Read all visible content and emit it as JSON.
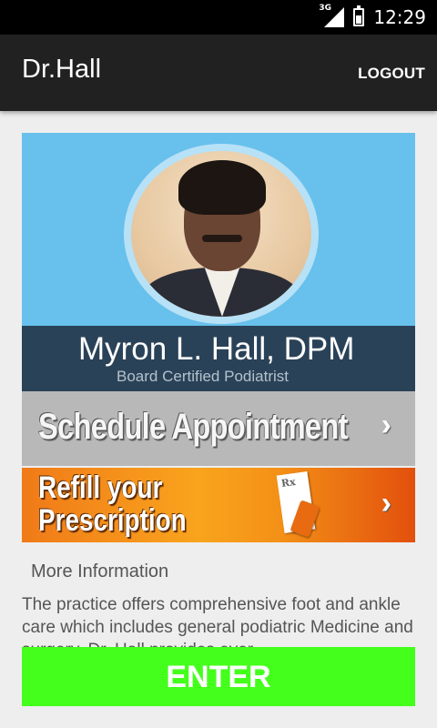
{
  "status_bar": {
    "network": "3G",
    "time": "12:29"
  },
  "app_bar": {
    "title": "Dr.Hall",
    "logout_label": "LOGOUT"
  },
  "doctor": {
    "name": "Myron L. Hall, DPM",
    "title": "Board Certified Podiatrist"
  },
  "actions": {
    "schedule_label": "Schedule Appointment",
    "refill_line1": "Refill your",
    "refill_line2": "Prescription",
    "rx_mark": "Rx"
  },
  "info": {
    "heading": "More Information",
    "description": "The practice offers comprehensive foot and ankle care which includes general podiatric Medicine and surgery. Dr. Hall provides ever"
  },
  "enter": {
    "label": "ENTER"
  },
  "colors": {
    "status_bar": "#000000",
    "app_bar": "#212121",
    "hero_background": "#68c0ec",
    "name_banner": "#2a4258",
    "schedule_button": "#b8b8b8",
    "refill_button": "#f49117",
    "enter_button": "#44ff1c",
    "page_background": "#eeeeee"
  },
  "icons": {
    "signal": "cell-signal-icon",
    "battery": "battery-charging-icon",
    "schedule_arrow": "chevron-right-icon",
    "refill_arrow": "chevron-right-icon"
  }
}
